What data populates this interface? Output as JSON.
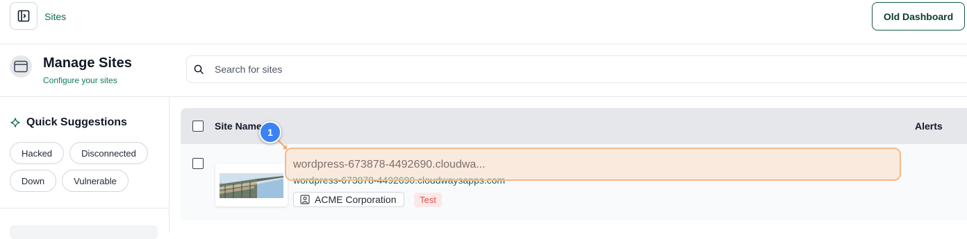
{
  "topbar": {
    "breadcrumb": "Sites",
    "old_dashboard_label": "Old Dashboard",
    "sidebar_toggle_icon": "sidebar-toggle-icon"
  },
  "header": {
    "title": "Manage Sites",
    "subtitle": "Configure your sites",
    "icon": "browser-window-icon"
  },
  "search": {
    "placeholder": "Search for sites",
    "value": "",
    "icon": "search-icon"
  },
  "sidebar": {
    "quick_suggestions_title": "Quick Suggestions",
    "quick_suggestions_icon": "sparkle-icon",
    "chips": [
      "Hacked",
      "Disconnected",
      "Down",
      "Vulnerable"
    ]
  },
  "table": {
    "columns": [
      "Site Name",
      "Alerts"
    ],
    "rows": [
      {
        "title": "wordpress-673878-4492690.cloudwa...",
        "url": "wordpress-673878-4492690.cloudwaysapps.com",
        "owner": "ACME Corporation",
        "tag": "Test"
      }
    ]
  },
  "annotation": {
    "badge_number": "1",
    "highlight_color": "#f5b98a",
    "badge_color": "#3b82f6"
  },
  "colors": {
    "brand_green": "#0f6b4f",
    "tag_red": "#e0524c"
  }
}
